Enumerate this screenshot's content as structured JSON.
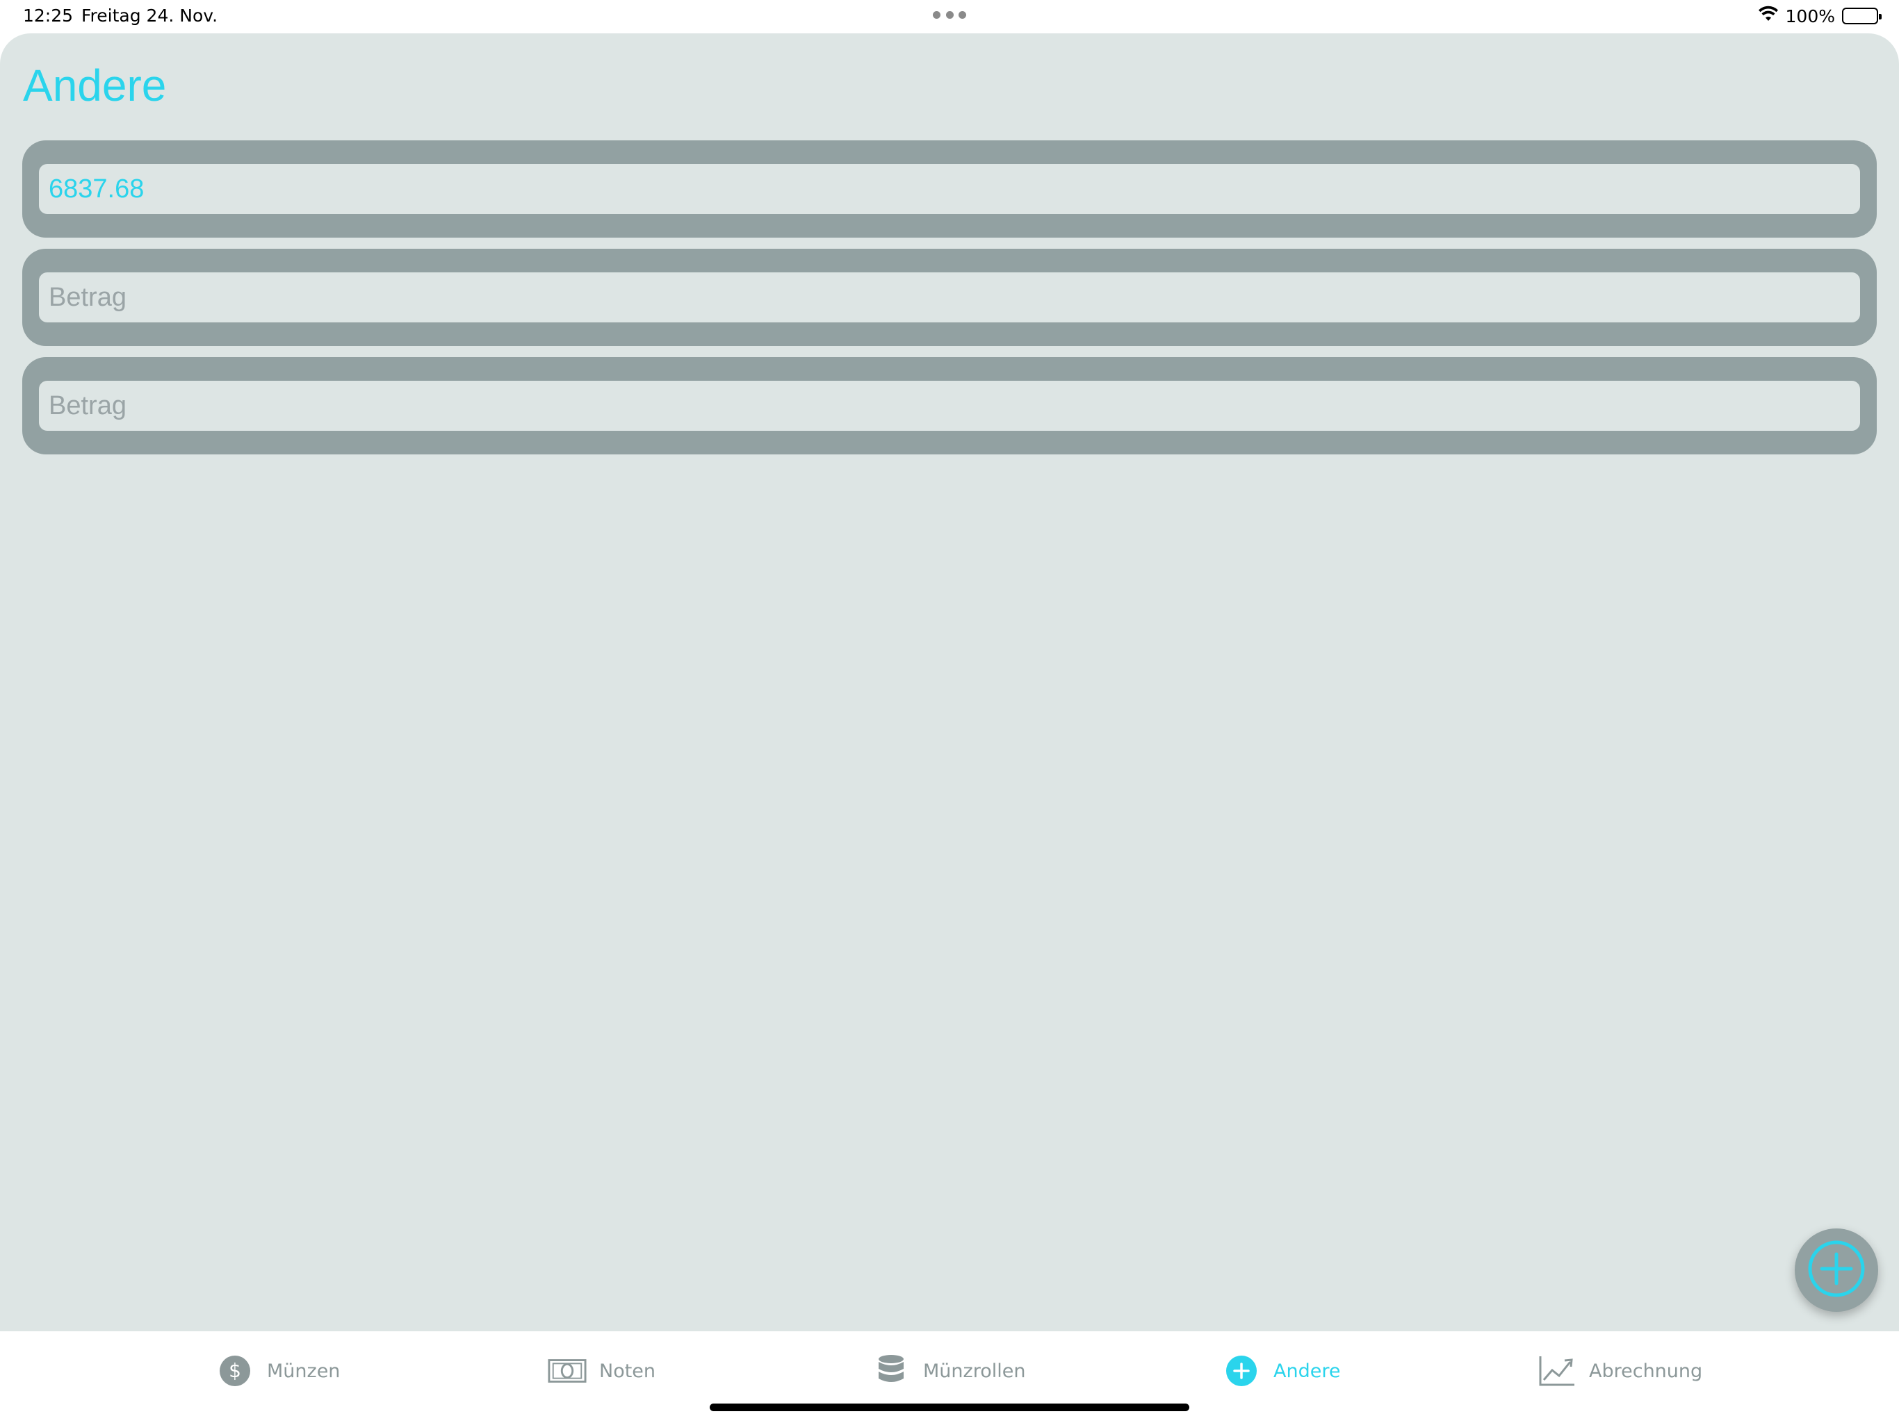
{
  "status": {
    "time": "12:25",
    "date": "Freitag 24. Nov.",
    "battery": "100%"
  },
  "page": {
    "title": "Andere"
  },
  "fields": [
    {
      "value": "6837.68",
      "placeholder": "Betrag"
    },
    {
      "value": "",
      "placeholder": "Betrag"
    },
    {
      "value": "",
      "placeholder": "Betrag"
    }
  ],
  "tabs": [
    {
      "label": "Münzen",
      "icon": "dollar-circle-icon",
      "active": false
    },
    {
      "label": "Noten",
      "icon": "banknote-icon",
      "active": false
    },
    {
      "label": "Münzrollen",
      "icon": "coin-stack-icon",
      "active": false
    },
    {
      "label": "Andere",
      "icon": "plus-circle-icon",
      "active": true
    },
    {
      "label": "Abrechnung",
      "icon": "chart-line-icon",
      "active": false
    }
  ],
  "colors": {
    "accent": "#2ad4ec",
    "background": "#dde5e4",
    "card": "#92a1a2",
    "inactive": "#8c9899"
  }
}
